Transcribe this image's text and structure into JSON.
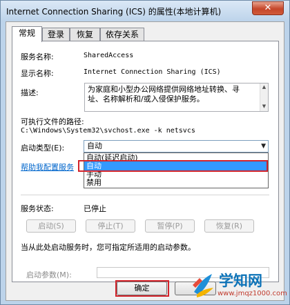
{
  "window": {
    "title": "Internet Connection Sharing (ICS) 的属性(本地计算机)",
    "close_glyph": "✕"
  },
  "tabs": [
    {
      "label": "常规",
      "active": true
    },
    {
      "label": "登录",
      "active": false
    },
    {
      "label": "恢复",
      "active": false
    },
    {
      "label": "依存关系",
      "active": false
    }
  ],
  "general": {
    "service_name_label": "服务名称:",
    "service_name_value": "SharedAccess",
    "display_name_label": "显示名称:",
    "display_name_value": "Internet Connection Sharing (ICS)",
    "description_label": "描述:",
    "description_line1": "为家庭和小型办公网络提供网络地址转换、寻",
    "description_line2": "址、名称解析和/或入侵保护服务。",
    "exe_path_label": "可执行文件的路径:",
    "exe_path_value": "C:\\Windows\\System32\\svchost.exe -k netsvcs",
    "startup_type_label": "启动类型(E):",
    "startup_type_selected": "自动",
    "startup_options": [
      "自动(延迟启动)",
      "自动",
      "手动",
      "禁用"
    ],
    "highlighted_option_index": 1,
    "help_link": "帮助我配置服务",
    "service_status_label": "服务状态:",
    "service_status_value": "已停止",
    "buttons": {
      "start": "启动(S)",
      "stop": "停止(T)",
      "pause": "暂停(P)",
      "resume": "恢复(R)"
    },
    "start_hint": "当从此处启动服务时，您可指定所适用的启动参数。",
    "start_params_label": "启动参数(M):"
  },
  "footer": {
    "ok_label": "确定"
  },
  "watermark": {
    "title": "学知网",
    "url": "www.jmqz1000.com"
  },
  "colors": {
    "highlight": "#3399ff",
    "annotation_red": "#d3232a",
    "link": "#0066cc"
  }
}
